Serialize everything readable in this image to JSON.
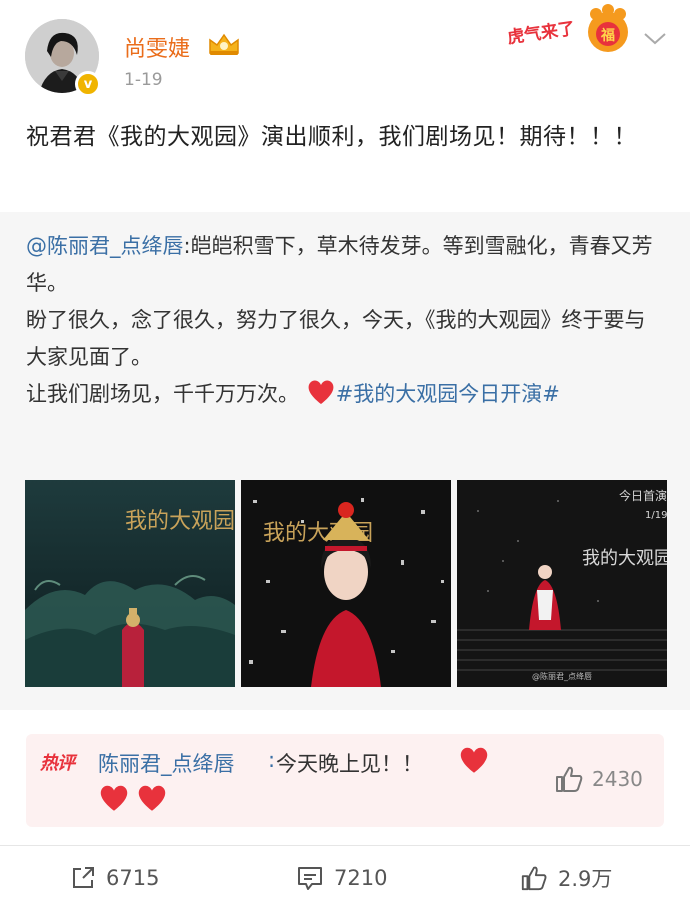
{
  "header": {
    "username": "尚雯婕",
    "time": "1-19",
    "verified_mark": "v",
    "avatar": "user-avatar",
    "badge": "tiger-new-year-badge",
    "badge_text": "虎气来了",
    "badge_glyph": "福",
    "menu_icon": "chevron-down-icon"
  },
  "post": {
    "text": "祝君君《我的大观园》演出顺利，我们剧场见！期待！！！"
  },
  "repost": {
    "mention": "@陈丽君_点绛唇",
    "line1": ":皑皑积雪下，草木待发芽。等到雪融化，青春又芳华。",
    "line2": "盼了很久，念了很久，努力了很久，今天，《我的大观园》终于要与大家见面了。",
    "line3": "让我们剧场见，千千万万次。",
    "hashtag": "#我的大观园今日开演#",
    "photos": [
      {
        "name": "poster-1",
        "title": "我的大观园"
      },
      {
        "name": "poster-2",
        "title": "我的大观园"
      },
      {
        "name": "poster-3",
        "title": "我的大观园",
        "top_text": "今日首演",
        "date": "1/19",
        "watermark": "@陈丽君_点绛唇"
      }
    ]
  },
  "hot_comment": {
    "tag": "热评",
    "author": "陈丽君_点绛唇",
    "colon": ":",
    "text": "今天晚上见！！",
    "likes": "2430"
  },
  "actions": {
    "share": "6715",
    "comment": "7210",
    "like": "2.9万"
  },
  "colors": {
    "username": "#ea6d1b",
    "link": "#3a6fa5",
    "heart": "#e8323c",
    "repost_bg": "#f6f6f6",
    "comment_bg": "#fdf1f1"
  }
}
